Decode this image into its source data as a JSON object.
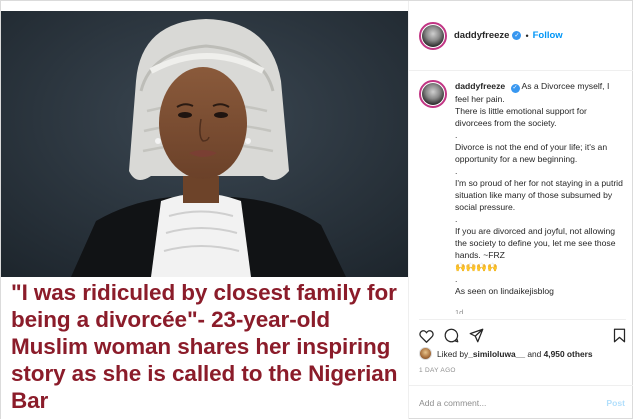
{
  "post": {
    "headline": "\"I was ridiculed by closest family for being a divorcée\"- 23-year-old Muslim woman shares her inspiring story as she is called to the Nigerian Bar"
  },
  "panel": {
    "username": "daddyfreeze",
    "verified_icon": "verified-badge-icon",
    "separator": "•",
    "follow_label": "Follow",
    "caption": {
      "username": "daddyfreeze",
      "text": "As a Divorcee myself, I feel her pain.\nThere is little emotional support for divorcees from the society.\n.\nDivorce is not the end of your life; it's an opportunity for a new beginning.\n.\nI'm so proud of her for not staying in a putrid situation like many of those subsumed by social pressure.\n.\nIf you are divorced and joyful, not allowing the society to define you, let me see those hands. ~FRZ\n🙌🙌🙌🙌\n.\nAs seen on lindaikejisblog",
      "time": "1d"
    },
    "likes": {
      "prefix": "Liked by ",
      "first_user": "_similoluwa__",
      "middle": " and ",
      "others": "4,950 others"
    },
    "date": "1 DAY AGO",
    "comment_placeholder": "Add a comment...",
    "post_label": "Post"
  },
  "colors": {
    "headline": "#8b1c2a",
    "link": "#0095f6",
    "verified": "#3897f0",
    "muted": "#8e8e8e"
  }
}
